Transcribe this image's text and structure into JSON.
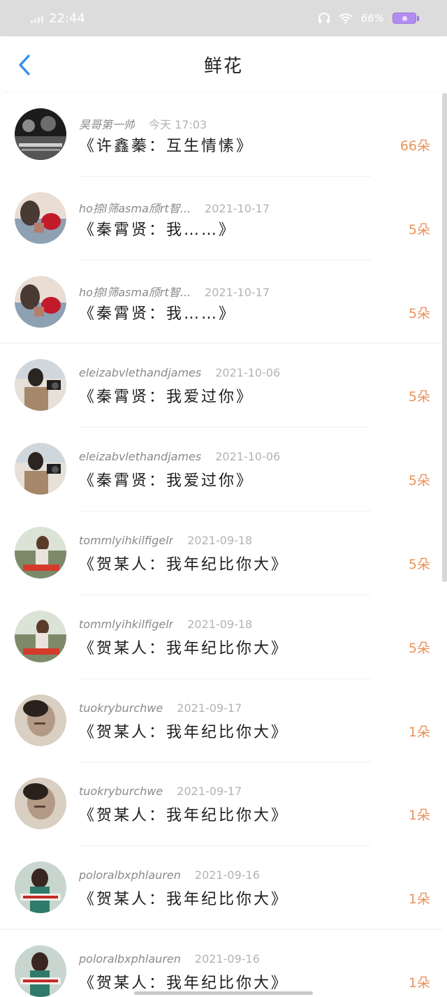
{
  "status_bar": {
    "time": "22:44",
    "battery": "66%"
  },
  "nav": {
    "title": "鲜花"
  },
  "rows": [
    {
      "user": "昊哥第一帅",
      "date": "今天 17:03",
      "title": "《许鑫蓁：互生情愫》",
      "count": "66朵",
      "avatar": "crowd-photo"
    },
    {
      "user": "ho捺l筛asma颀rt智...",
      "date": "2021-10-17",
      "title": "《秦霄贤：我……》",
      "count": "5朵",
      "avatar": "flower-kiss-photo"
    },
    {
      "user": "ho捺l筛asma颀rt智...",
      "date": "2021-10-17",
      "title": "《秦霄贤：我……》",
      "count": "5朵",
      "avatar": "flower-kiss-photo"
    },
    {
      "user": "eleizabvlethandjames",
      "date": "2021-10-06",
      "title": "《秦霄贤：我爱过你》",
      "count": "5朵",
      "avatar": "camera-man-photo"
    },
    {
      "user": "eleizabvlethandjames",
      "date": "2021-10-06",
      "title": "《秦霄贤：我爱过你》",
      "count": "5朵",
      "avatar": "camera-man-photo"
    },
    {
      "user": "tommlyihkilfigelr",
      "date": "2021-09-18",
      "title": "《贺某人：我年纪比你大》",
      "count": "5朵",
      "avatar": "girl-road-photo"
    },
    {
      "user": "tommlyihkilfigelr",
      "date": "2021-09-18",
      "title": "《贺某人：我年纪比你大》",
      "count": "5朵",
      "avatar": "girl-road-photo"
    },
    {
      "user": "tuokryburchwe",
      "date": "2021-09-17",
      "title": "《贺某人：我年纪比你大》",
      "count": "1朵",
      "avatar": "man-face-photo"
    },
    {
      "user": "tuokryburchwe",
      "date": "2021-09-17",
      "title": "《贺某人：我年纪比你大》",
      "count": "1朵",
      "avatar": "man-face-photo"
    },
    {
      "user": "poloralbxphlauren",
      "date": "2021-09-16",
      "title": "《贺某人：我年纪比你大》",
      "count": "1朵",
      "avatar": "girl-banner-photo"
    },
    {
      "user": "poloralbxphlauren",
      "date": "2021-09-16",
      "title": "《贺某人：我年纪比你大》",
      "count": "1朵",
      "avatar": "girl-banner-photo"
    }
  ],
  "colors": {
    "accent": "#2f8ef0",
    "count": "#e8935a"
  }
}
